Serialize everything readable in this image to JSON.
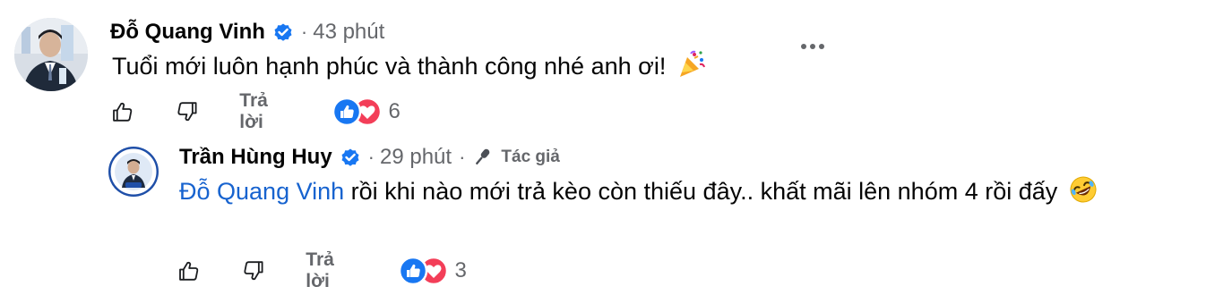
{
  "comment1": {
    "author": "Đỗ Quang Vinh",
    "time": "43 phút",
    "separator": "·",
    "text": "Tuổi mới luôn hạnh phúc và thành công nhé anh ơi!",
    "reply_label": "Trả lời",
    "reaction_count": "6"
  },
  "comment2": {
    "author": "Trần Hùng Huy",
    "time": "29 phút",
    "separator": "·",
    "badge": "Tác giả",
    "mention": "Đỗ Quang Vinh",
    "text": "rồi khi nào mới trả kèo còn thiếu đây.. khất mãi lên nhóm 4 rồi đấy",
    "reply_label": "Trả lời",
    "reaction_count": "3"
  },
  "colors": {
    "accent": "#1763cf",
    "verified": "#1877f2",
    "love": "#f33e58",
    "muted": "#65676b"
  }
}
